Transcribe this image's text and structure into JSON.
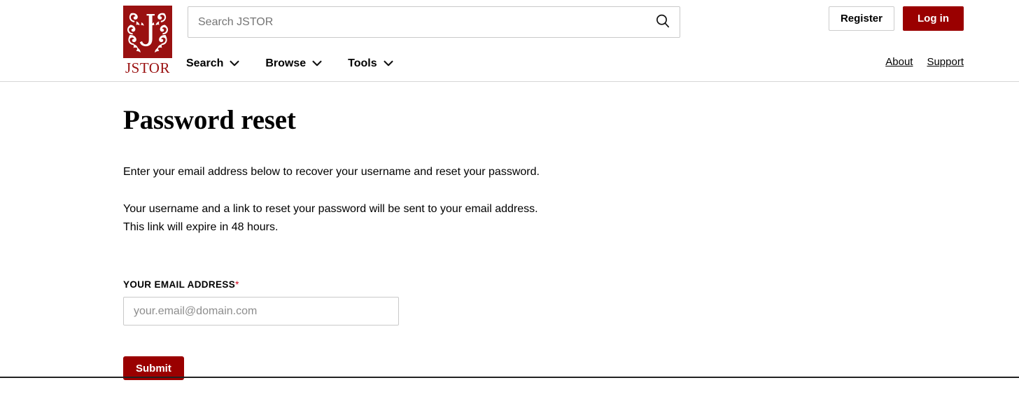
{
  "header": {
    "logo": {
      "mark_icon": "jstor-monogram-icon",
      "wordmark": "JSTOR",
      "brand_color": "#9a1111"
    },
    "search": {
      "placeholder": "Search JSTOR",
      "value": "",
      "icon": "search-icon"
    },
    "nav_items": [
      {
        "label": "Search",
        "icon": "chevron-down-icon"
      },
      {
        "label": "Browse",
        "icon": "chevron-down-icon"
      },
      {
        "label": "Tools",
        "icon": "chevron-down-icon"
      }
    ],
    "account": {
      "register_label": "Register",
      "login_label": "Log in",
      "login_bg": "#9a0000"
    },
    "secondary_links": [
      {
        "label": "About"
      },
      {
        "label": "Support"
      }
    ]
  },
  "main": {
    "title": "Password reset",
    "paragraph_1": "Enter your email address below to recover your username and reset your password.",
    "paragraph_2": "Your username and a link to reset your password will be sent to your email address. This link will expire in 48 hours.",
    "form": {
      "email_label": "YOUR EMAIL ADDRESS",
      "required_marker": "*",
      "required_color": "#d0021b",
      "email_placeholder": "your.email@domain.com",
      "email_value": "",
      "submit_label": "Submit",
      "submit_bg": "#9a0000"
    }
  }
}
